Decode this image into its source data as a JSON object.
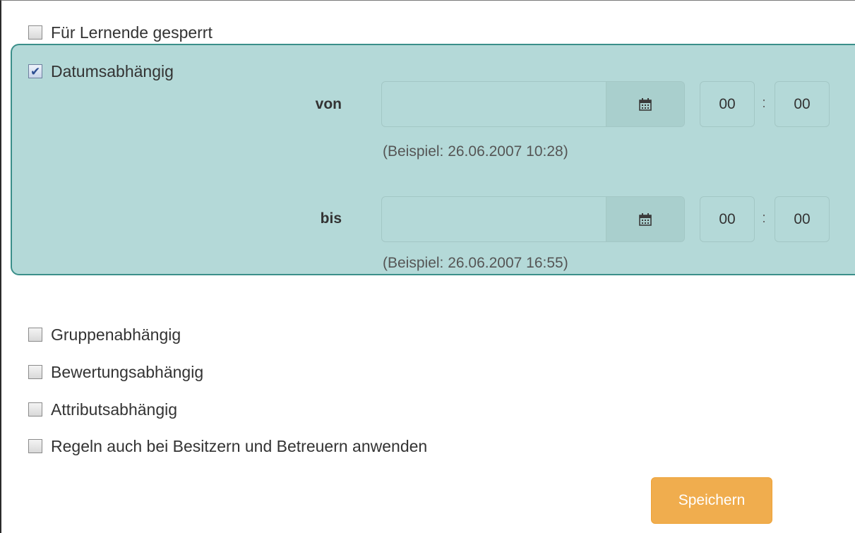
{
  "checkboxes": {
    "locked": {
      "label": "Für Lernende gesperrt",
      "checked": false
    },
    "date_dependent": {
      "label": "Datumsabhängig",
      "checked": true
    },
    "group_dependent": {
      "label": "Gruppenabhängig",
      "checked": false
    },
    "assessment_dependent": {
      "label": "Bewertungsabhängig",
      "checked": false
    },
    "attribute_dependent": {
      "label": "Attributsabhängig",
      "checked": false
    },
    "apply_to_owners": {
      "label": "Regeln auch bei Besitzern und Betreuern anwenden",
      "checked": false
    }
  },
  "date_from": {
    "label": "von",
    "date_value": "",
    "hour": "00",
    "minute": "00",
    "separator": ":",
    "hint": "(Beispiel: 26.06.2007 10:28)",
    "calendar_icon": "calendar-icon"
  },
  "date_to": {
    "label": "bis",
    "date_value": "",
    "hour": "00",
    "minute": "00",
    "separator": ":",
    "hint": "(Beispiel: 26.06.2007 16:55)",
    "calendar_icon": "calendar-icon"
  },
  "actions": {
    "save_label": "Speichern"
  },
  "colors": {
    "panel_bg": "#b4d9d8",
    "panel_border": "#3b8f8a",
    "save_button": "#f0ad4e"
  }
}
